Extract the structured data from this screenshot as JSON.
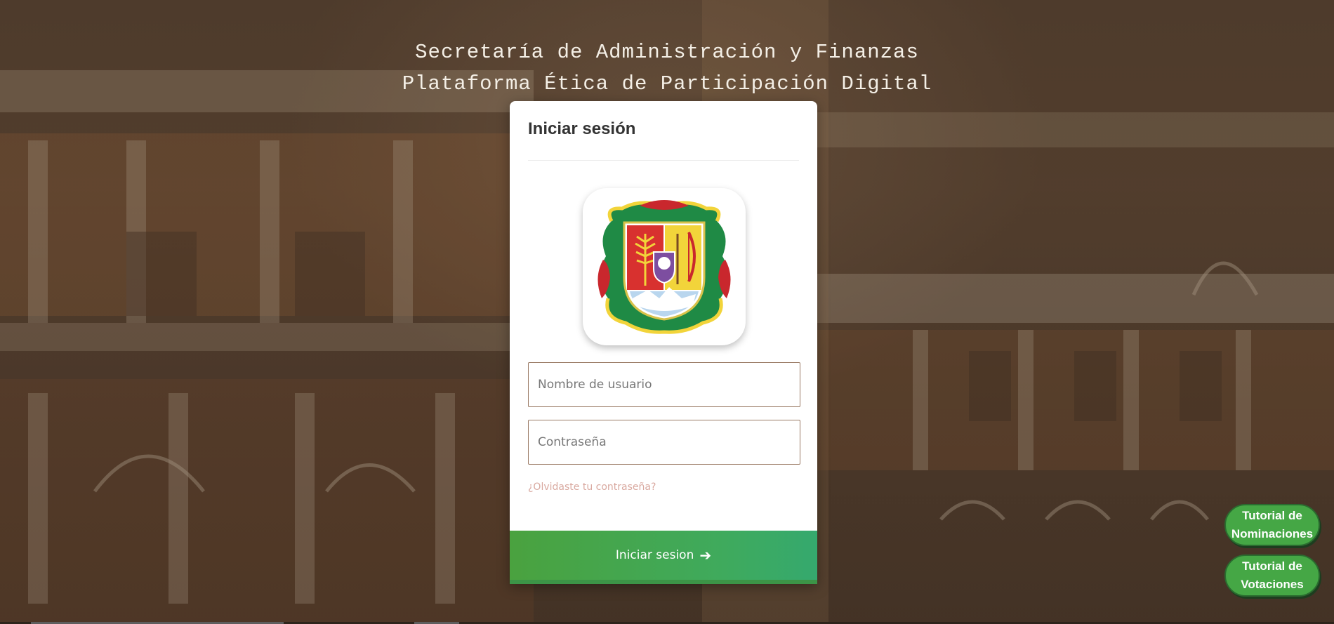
{
  "header": {
    "line1": "Secretaría de Administración y Finanzas",
    "line2": "Plataforma Ética de Participación Digital"
  },
  "login": {
    "title": "Iniciar sesión",
    "logo": "state-coat-of-arms-logo",
    "username_placeholder": "Nombre de usuario",
    "password_placeholder": "Contraseña",
    "forgot_link": "¿Olvidaste tu contraseña?",
    "submit_label": "Iniciar sesion",
    "submit_icon": "arrow-right-icon"
  },
  "tutorials": {
    "nominaciones_line1": "Tutorial de",
    "nominaciones_line2": "Nominaciones",
    "votaciones_line1": "Tutorial de",
    "votaciones_line2": "Votaciones"
  },
  "colors": {
    "accent_green": "#45a745",
    "link": "#d9a9a0",
    "overlay_brown": "#463426"
  }
}
